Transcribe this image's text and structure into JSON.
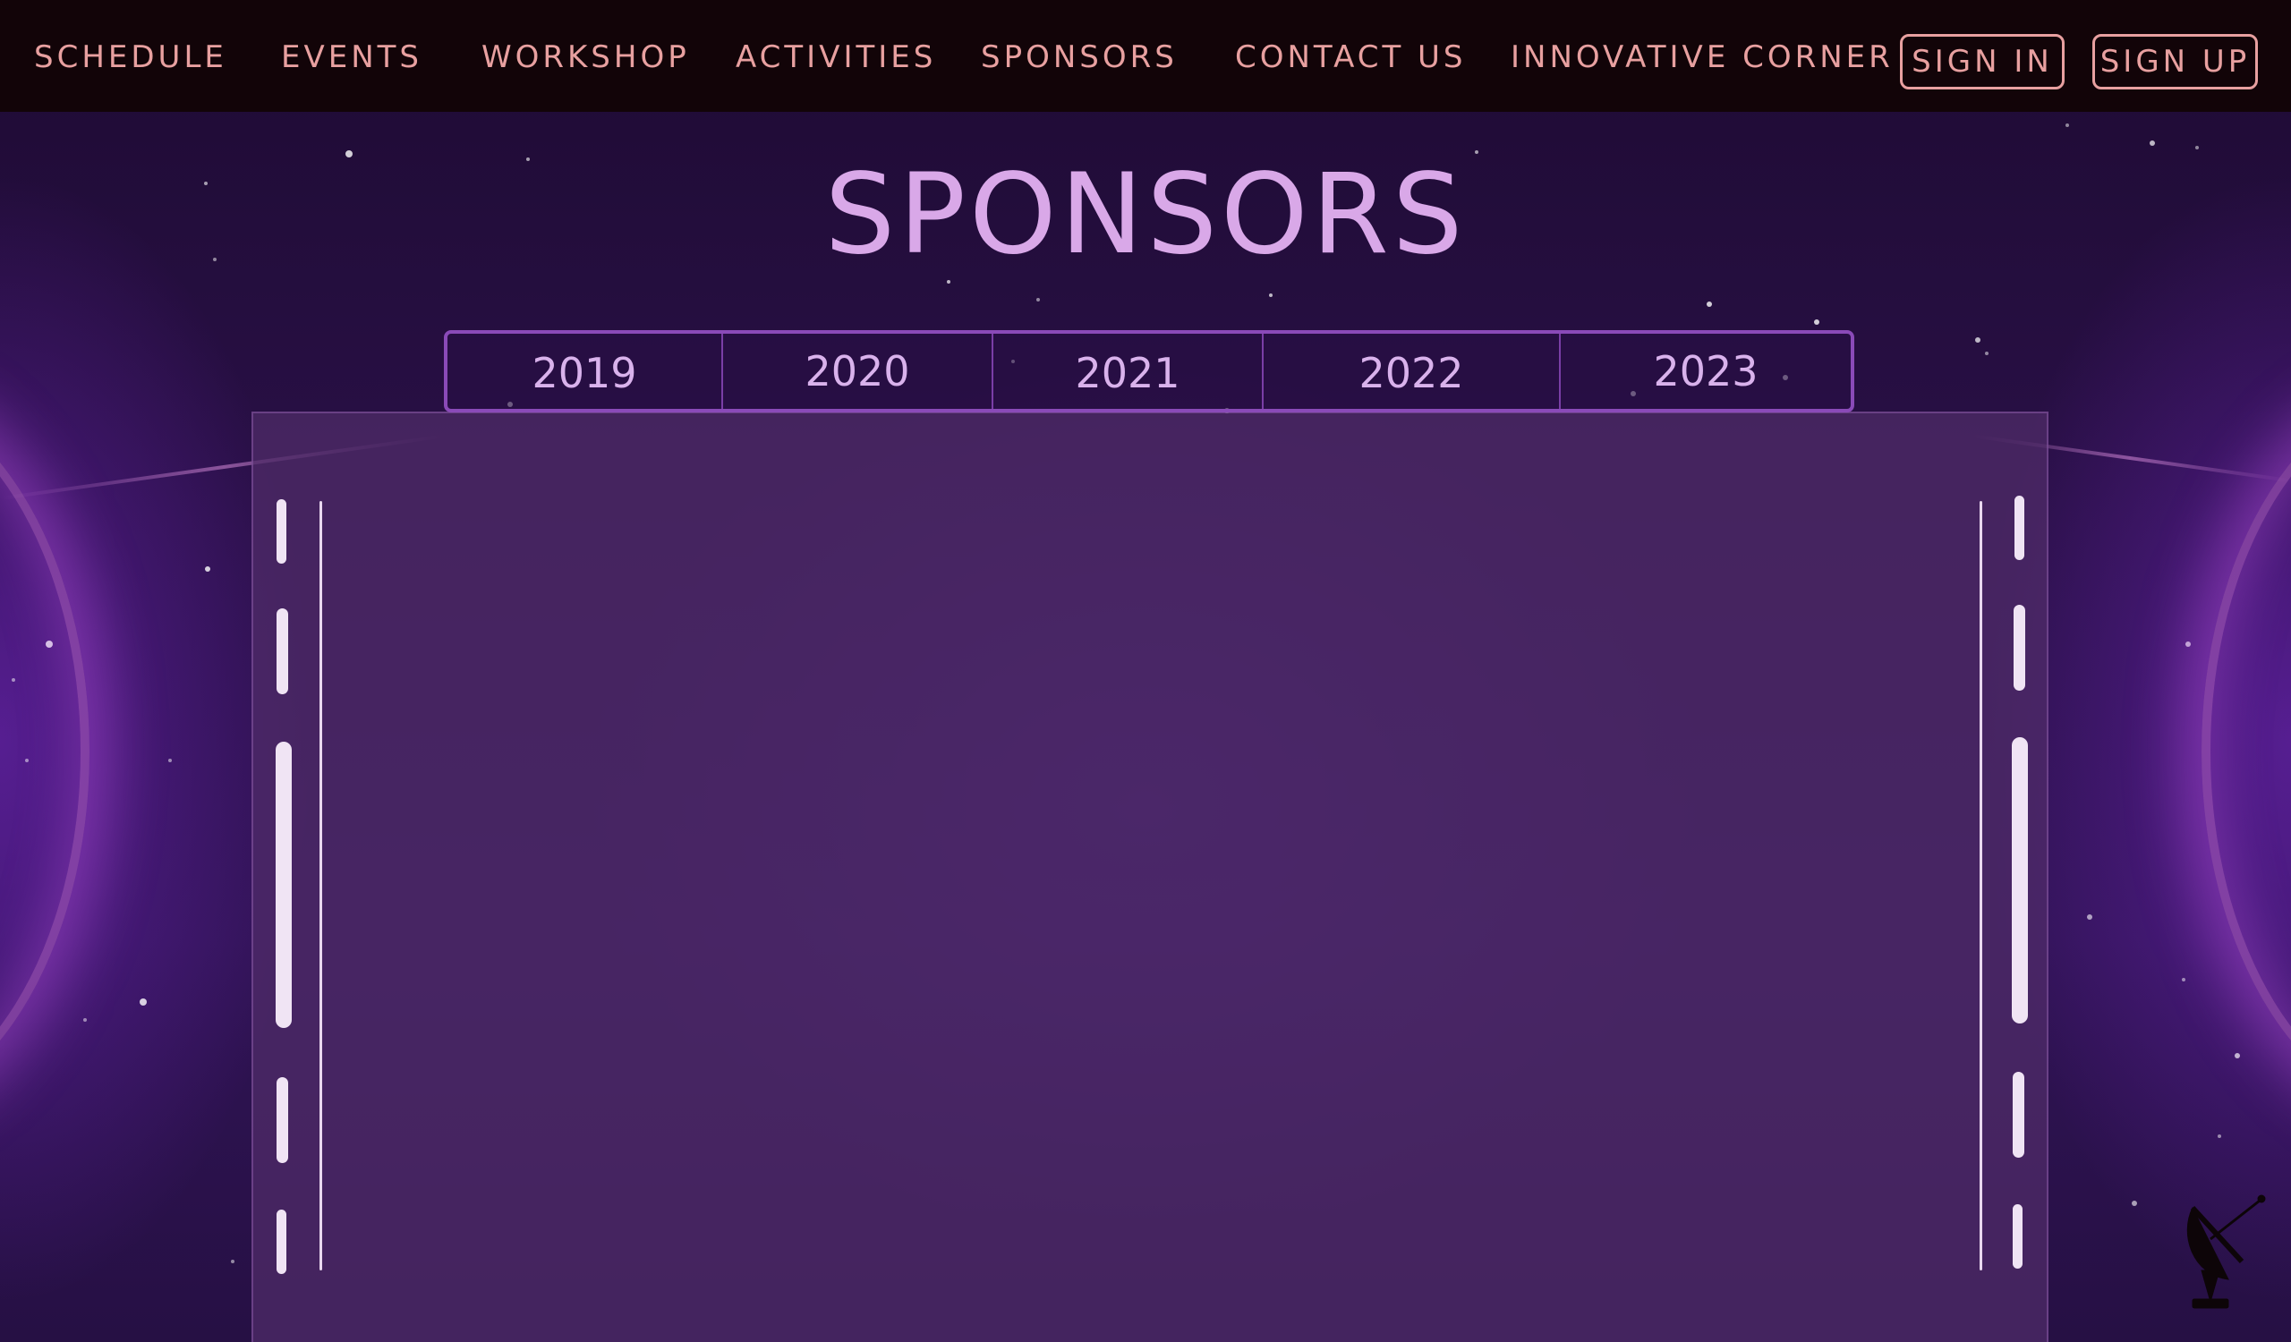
{
  "nav": {
    "items": [
      {
        "label": "SCHEDULE"
      },
      {
        "label": "EVENTS"
      },
      {
        "label": "WORKSHOP"
      },
      {
        "label": "ACTIVITIES"
      },
      {
        "label": "SPONSORS"
      },
      {
        "label": "CONTACT US"
      },
      {
        "label": "INNOVATIVE CORNER"
      }
    ],
    "sign_in": "SIGN IN",
    "sign_up": "SIGN UP"
  },
  "page_title": "SPONSORS",
  "years": [
    "2019",
    "2020",
    "2021",
    "2022",
    "2023"
  ],
  "colors": {
    "nav_text": "#e8a0a0",
    "title": "#d9a8e8",
    "tab_border": "#8a4ab8"
  },
  "icons": {
    "satellite": "satellite-dish-icon"
  }
}
